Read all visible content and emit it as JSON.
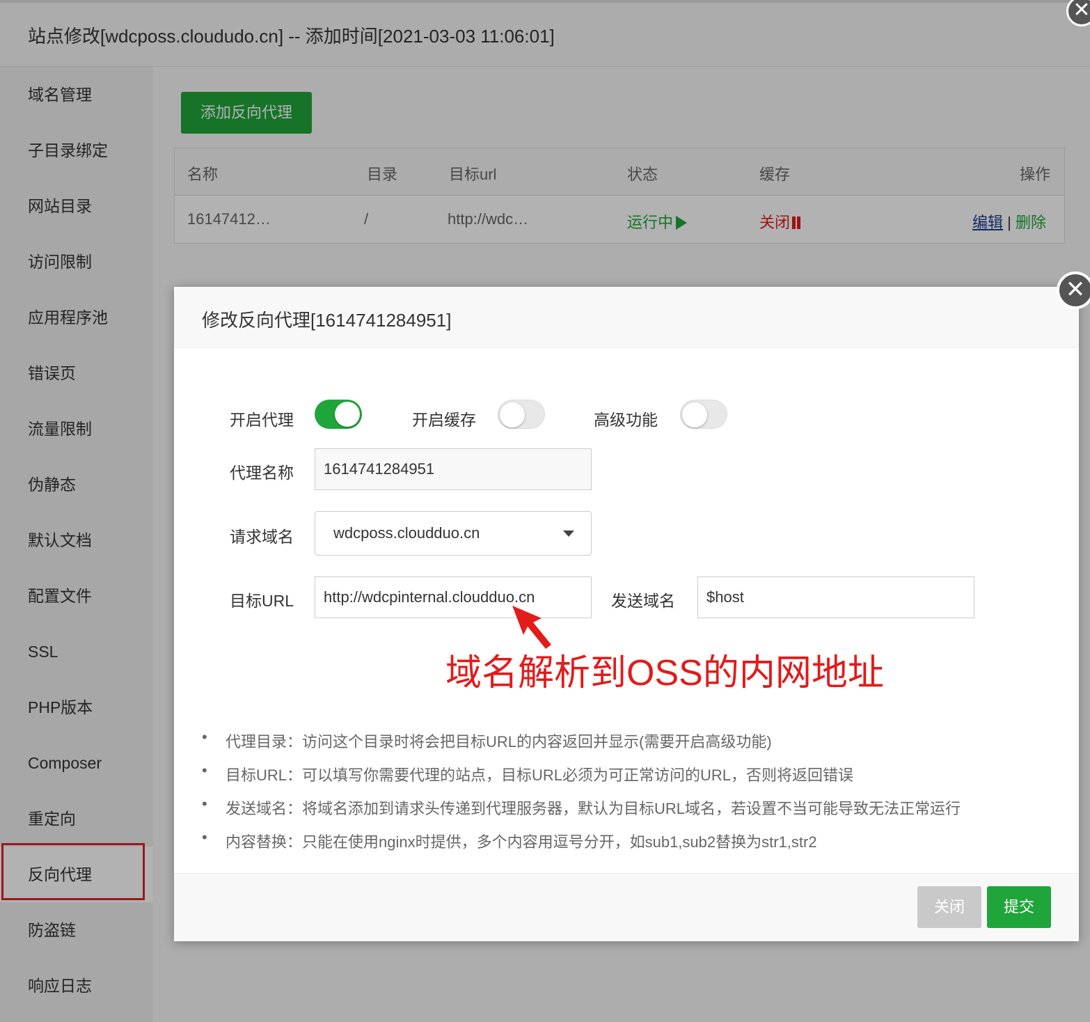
{
  "panel": {
    "title": "站点修改[wdcposs.cloududo.cn] -- 添加时间[2021-03-03 11:06:01]",
    "close_glyph": "✕"
  },
  "sidebar": {
    "active": "反向代理",
    "items": [
      {
        "label": "域名管理"
      },
      {
        "label": "子目录绑定"
      },
      {
        "label": "网站目录"
      },
      {
        "label": "访问限制"
      },
      {
        "label": "应用程序池"
      },
      {
        "label": "错误页"
      },
      {
        "label": "流量限制"
      },
      {
        "label": "伪静态"
      },
      {
        "label": "默认文档"
      },
      {
        "label": "配置文件"
      },
      {
        "label": "SSL"
      },
      {
        "label": "PHP版本"
      },
      {
        "label": "Composer"
      },
      {
        "label": "重定向"
      },
      {
        "label": "反向代理"
      },
      {
        "label": "防盗链"
      },
      {
        "label": "响应日志"
      }
    ]
  },
  "toolbar": {
    "add_label": "添加反向代理"
  },
  "table": {
    "headers": {
      "name": "名称",
      "dir": "目录",
      "url": "目标url",
      "status": "状态",
      "cache": "缓存",
      "action": "操作"
    },
    "rows": [
      {
        "name": "16147412…",
        "dir": "/",
        "url": "http://wdc…",
        "status": "运行中",
        "cache": "关闭",
        "edit": "编辑",
        "sep": "|",
        "delete": "删除"
      }
    ]
  },
  "colors": {
    "accent_green": "#20a53a",
    "danger_red": "#e21b1b",
    "link_blue": "#1c3c8c"
  },
  "modal": {
    "title": "修改反向代理[1614741284951]",
    "close_glyph": "✕",
    "toggles": {
      "proxy": {
        "label": "开启代理",
        "on": true
      },
      "cache": {
        "label": "开启缓存",
        "on": false
      },
      "advanced": {
        "label": "高级功能",
        "on": false
      }
    },
    "fields": {
      "name_label": "代理名称",
      "name_value": "1614741284951",
      "domain_label": "请求域名",
      "domain_value": "wdcposs.cloudduo.cn",
      "target_label": "目标URL",
      "target_value": "http://wdcpinternal.cloudduo.cn",
      "send_label": "发送域名",
      "send_value": "$host"
    },
    "annotation": "域名解析到OSS的内网地址",
    "tips": [
      "代理目录：访问这个目录时将会把目标URL的内容返回并显示(需要开启高级功能)",
      "目标URL：可以填写你需要代理的站点，目标URL必须为可正常访问的URL，否则将返回错误",
      "发送域名：将域名添加到请求头传递到代理服务器，默认为目标URL域名，若设置不当可能导致无法正常运行",
      "内容替换：只能在使用nginx时提供，多个内容用逗号分开，如sub1,sub2替换为str1,str2"
    ],
    "buttons": {
      "close": "关闭",
      "submit": "提交"
    }
  }
}
